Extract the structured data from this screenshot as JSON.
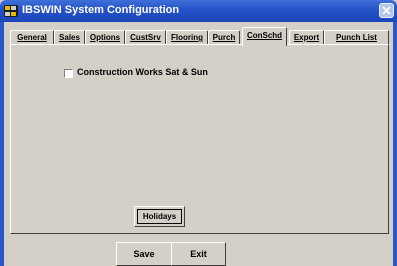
{
  "window": {
    "title": "IBSWIN System Configuration",
    "titlebar_color": "#2452c9"
  },
  "tabs": [
    {
      "label": "General",
      "active": false
    },
    {
      "label": "Sales",
      "active": false
    },
    {
      "label": "Options",
      "active": false
    },
    {
      "label": "CustSrv",
      "active": false
    },
    {
      "label": "Flooring",
      "active": false
    },
    {
      "label": "Purch",
      "active": false
    },
    {
      "label": "ConSchd",
      "active": true
    },
    {
      "label": "Export",
      "active": false
    },
    {
      "label": "Punch List",
      "active": false
    }
  ],
  "conschd": {
    "checkbox_label": "Construction Works Sat & Sun",
    "checked": false,
    "holidays_label": "Holidays"
  },
  "footer": {
    "save_label": "Save",
    "exit_label": "Exit"
  },
  "icons": [
    "app-icon",
    "close-icon",
    "checkbox-icon"
  ]
}
